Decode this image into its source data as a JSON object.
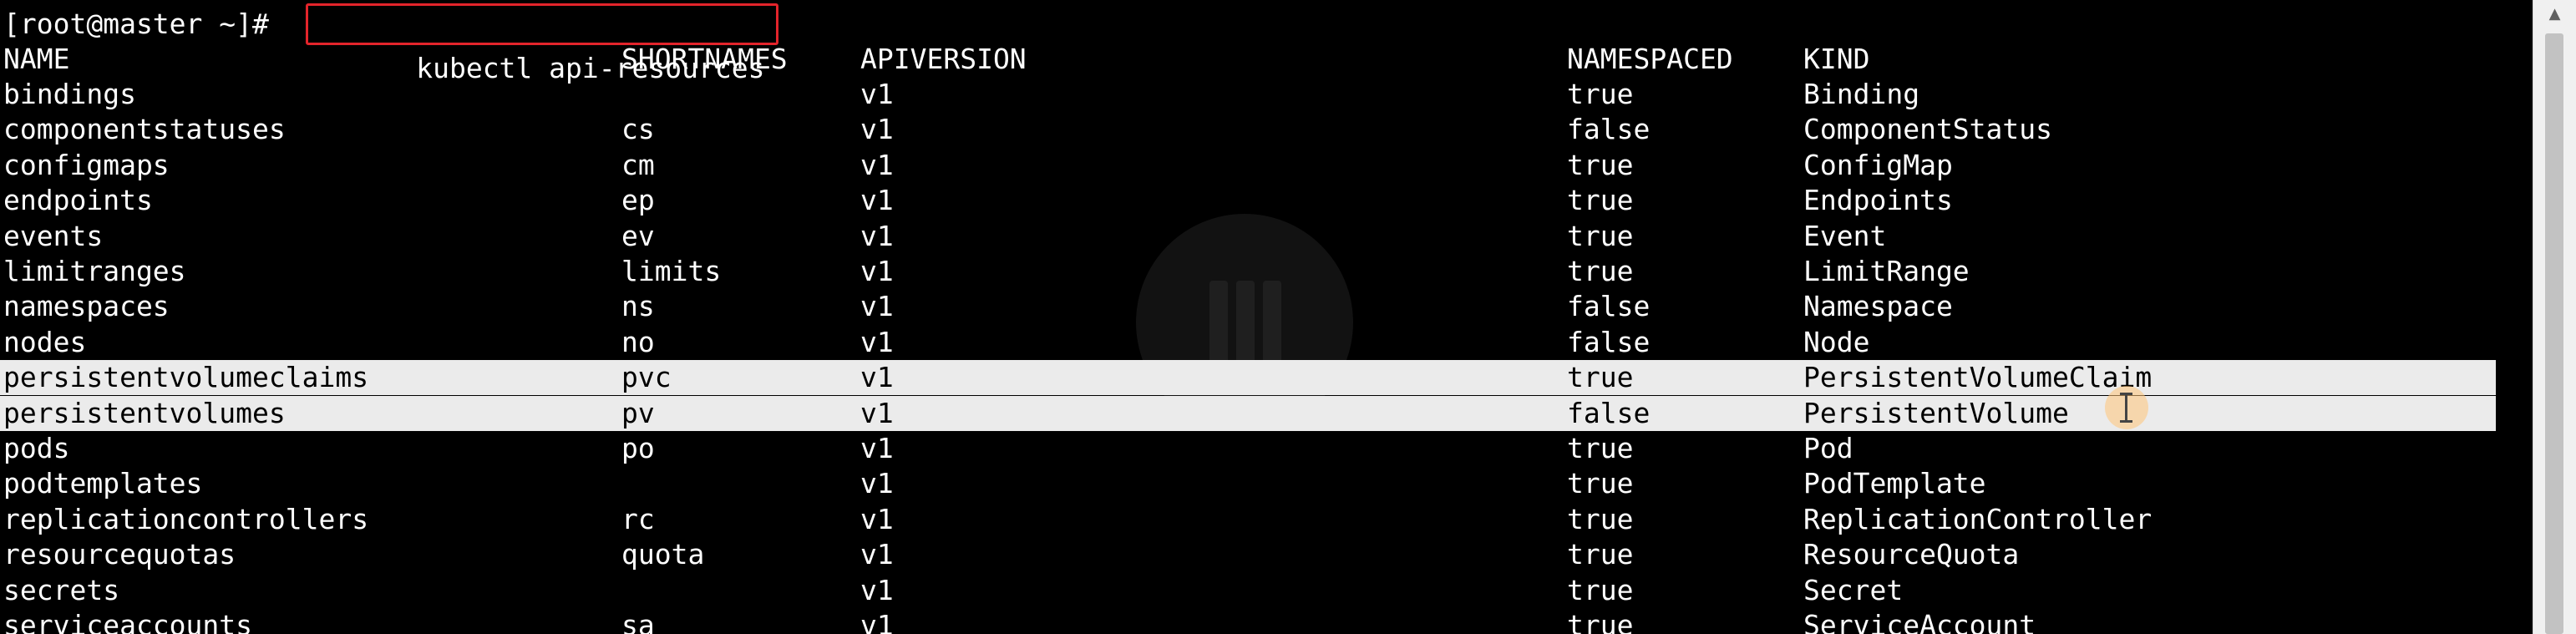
{
  "terminal": {
    "prompt": "[root@master ~]# ",
    "command": "kubectl api-resources",
    "colors": {
      "background": "#000000",
      "text": "#ffffff",
      "command_highlight_border": "#e3242b",
      "selected_row_background": "#ebebeb"
    },
    "headers": {
      "name": "NAME",
      "shortnames": "SHORTNAMES",
      "apiversion": "APIVERSION",
      "namespaced": "NAMESPACED",
      "kind": "KIND"
    },
    "rows": [
      {
        "name": "bindings",
        "shortnames": "",
        "apiversion": "v1",
        "namespaced": "true",
        "kind": "Binding"
      },
      {
        "name": "componentstatuses",
        "shortnames": "cs",
        "apiversion": "v1",
        "namespaced": "false",
        "kind": "ComponentStatus"
      },
      {
        "name": "configmaps",
        "shortnames": "cm",
        "apiversion": "v1",
        "namespaced": "true",
        "kind": "ConfigMap"
      },
      {
        "name": "endpoints",
        "shortnames": "ep",
        "apiversion": "v1",
        "namespaced": "true",
        "kind": "Endpoints"
      },
      {
        "name": "events",
        "shortnames": "ev",
        "apiversion": "v1",
        "namespaced": "true",
        "kind": "Event"
      },
      {
        "name": "limitranges",
        "shortnames": "limits",
        "apiversion": "v1",
        "namespaced": "true",
        "kind": "LimitRange"
      },
      {
        "name": "namespaces",
        "shortnames": "ns",
        "apiversion": "v1",
        "namespaced": "false",
        "kind": "Namespace"
      },
      {
        "name": "nodes",
        "shortnames": "no",
        "apiversion": "v1",
        "namespaced": "false",
        "kind": "Node"
      },
      {
        "name": "persistentvolumeclaims",
        "shortnames": "pvc",
        "apiversion": "v1",
        "namespaced": "true",
        "kind": "PersistentVolumeClaim",
        "selected": true
      },
      {
        "name": "persistentvolumes",
        "shortnames": "pv",
        "apiversion": "v1",
        "namespaced": "false",
        "kind": "PersistentVolume",
        "selected": true
      },
      {
        "name": "pods",
        "shortnames": "po",
        "apiversion": "v1",
        "namespaced": "true",
        "kind": "Pod"
      },
      {
        "name": "podtemplates",
        "shortnames": "",
        "apiversion": "v1",
        "namespaced": "true",
        "kind": "PodTemplate"
      },
      {
        "name": "replicationcontrollers",
        "shortnames": "rc",
        "apiversion": "v1",
        "namespaced": "true",
        "kind": "ReplicationController"
      },
      {
        "name": "resourcequotas",
        "shortnames": "quota",
        "apiversion": "v1",
        "namespaced": "true",
        "kind": "ResourceQuota"
      },
      {
        "name": "secrets",
        "shortnames": "",
        "apiversion": "v1",
        "namespaced": "true",
        "kind": "Secret"
      },
      {
        "name": "serviceaccounts",
        "shortnames": "sa",
        "apiversion": "v1",
        "namespaced": "true",
        "kind": "ServiceAccount"
      }
    ]
  },
  "scrollbar": {
    "up_arrow_icon": "triangle-up-icon",
    "up_arrow_glyph": "▲"
  },
  "cursor": {
    "icon": "text-cursor-icon"
  }
}
